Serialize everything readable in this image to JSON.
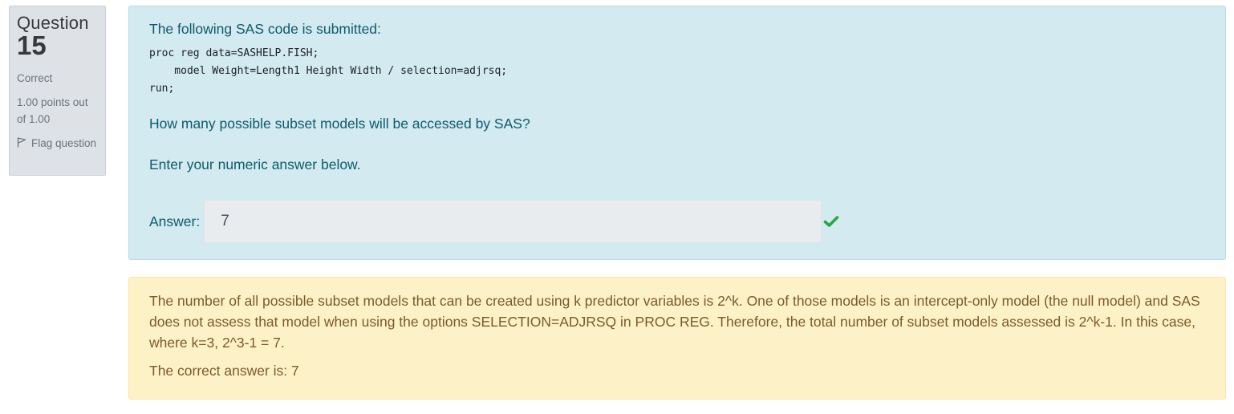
{
  "question_info": {
    "question_word": "Question",
    "number": "15",
    "state": "Correct",
    "grade": "1.00 points out of 1.00",
    "flag_label": "Flag question",
    "flag_icon": "flag-outline-icon"
  },
  "formulation": {
    "intro": "The following SAS code is submitted:",
    "code_lines": [
      "proc reg data=SASHELP.FISH;",
      "    model Weight=Length1 Height Width / selection=adjrsq;",
      "run;"
    ],
    "question": "How many possible subset models will be accessed by SAS?",
    "prompt": "Enter your numeric answer below.",
    "answer_label": "Answer:",
    "answer_value": "7",
    "answer_status_icon": "check-icon",
    "answer_status_color": "#28a745"
  },
  "outcome": {
    "feedback": "The number of all possible subset models that can be created using k predictor variables is 2^k. One of those models is an intercept-only model (the null model) and SAS does not assess that model when using the options SELECTION=ADJRSQ in PROC REG. Therefore, the total number of subset models assessed is 2^k-1. In this case, where k=3, 2^3-1 = 7.",
    "right_answer": "The correct answer is: 7"
  },
  "colors": {
    "info_bg": "#dee2e6",
    "formulation_bg": "#d2eaf0",
    "formulation_text": "#0e5b6a",
    "outcome_bg": "#fdf1c8",
    "outcome_text": "#7d5a29"
  }
}
